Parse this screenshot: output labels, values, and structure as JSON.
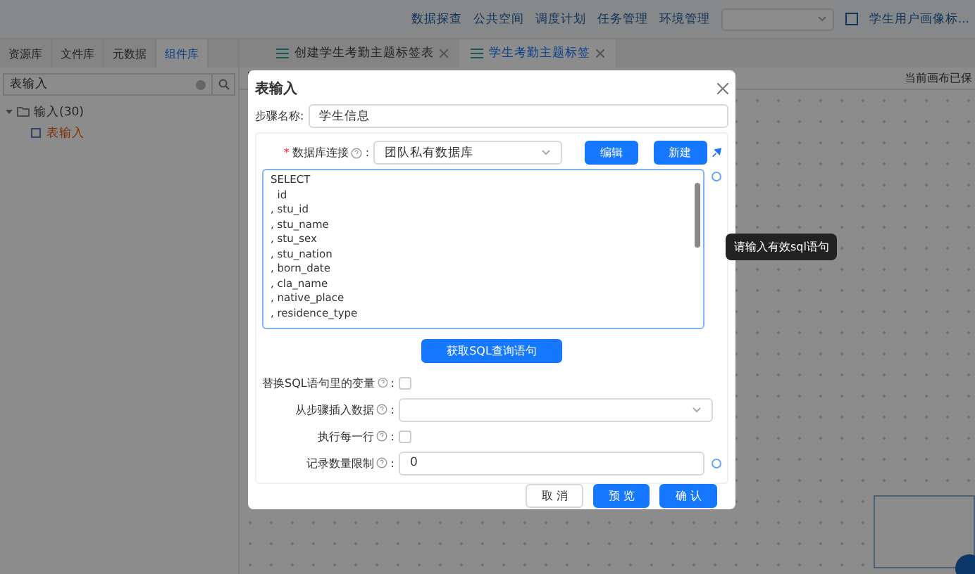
{
  "top_nav": {
    "links": [
      "数据探查",
      "公共空间",
      "调度计划",
      "任务管理",
      "环境管理"
    ],
    "project": "学生用户画像标..."
  },
  "left_panel": {
    "tabs": [
      {
        "label": "资源库",
        "selected": false
      },
      {
        "label": "文件库",
        "selected": false
      },
      {
        "label": "元数据",
        "selected": false
      },
      {
        "label": "组件库",
        "selected": true
      }
    ],
    "search": {
      "value": "表输入"
    },
    "tree": [
      {
        "label": "输入(30)",
        "expanded": true,
        "selected": false,
        "children": [
          {
            "label": "表输入",
            "selected": true
          }
        ]
      }
    ]
  },
  "editor_tabs": [
    {
      "label": "创建学生考勤主题标签表",
      "selected": false
    },
    {
      "label": "学生考勤主题标签",
      "selected": true
    }
  ],
  "canvas_status": "当前画布已保",
  "dialog": {
    "title": "表输入",
    "step_name_label": "步骤名称:",
    "step_name": "学生信息",
    "db_label": "数据库连接",
    "required_mark": "*",
    "label_colon": ":",
    "db_value": "团队私有数据库",
    "edit_button": "编辑",
    "new_button": "新建",
    "sql_lines": [
      "SELECT",
      "  id",
      ", stu_id",
      ", stu_name",
      ", stu_sex",
      ", stu_nation",
      ", born_date",
      ", cla_name",
      ", native_place",
      ", residence_type"
    ],
    "tooltip": "请输入有效sql语句",
    "get_sql_button": "获取SQL查询语句",
    "options": [
      {
        "kind": "checkbox",
        "label": "替换SQL语句里的变量",
        "checked": false
      },
      {
        "kind": "select",
        "label": "从步骤插入数据"
      },
      {
        "kind": "checkbox",
        "label": "执行每一行",
        "checked": false
      },
      {
        "kind": "input",
        "label": "记录数量限制",
        "value": "0"
      }
    ],
    "buttons": [
      {
        "label": "取 消",
        "primary": false
      },
      {
        "label": "预 览",
        "primary": true
      },
      {
        "label": "确 认",
        "primary": true
      }
    ]
  }
}
